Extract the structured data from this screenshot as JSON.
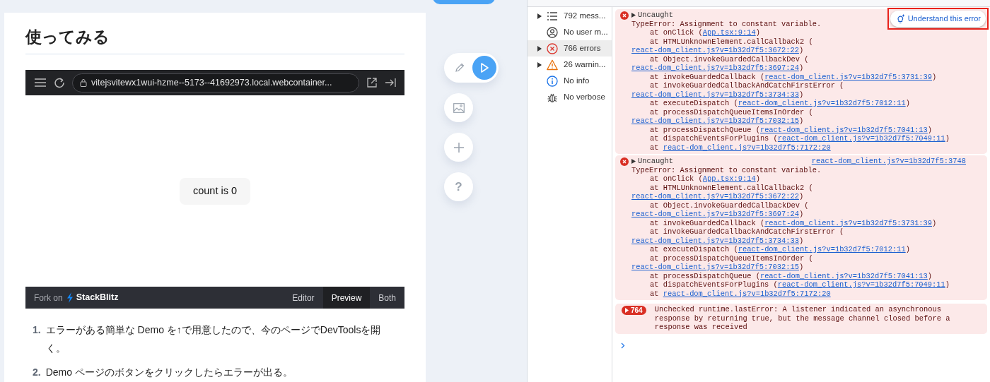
{
  "article": {
    "heading": "使ってみる",
    "embed": {
      "url": "vitejsvitewx1wui-hzme--5173--41692973.local.webcontainer...",
      "preview_button": "count is 0",
      "fork_label": "Fork on",
      "brand": "StackBlitz",
      "tabs": [
        {
          "label": "Editor",
          "selected": false
        },
        {
          "label": "Preview",
          "selected": true
        },
        {
          "label": "Both",
          "selected": false
        }
      ]
    },
    "steps": [
      {
        "number": "1.",
        "text": "エラーがある簡単な Demo を↑で用意したので、今のページでDevToolsを開く。"
      },
      {
        "number": "2.",
        "text": "Demo ページのボタンをクリックしたらエラーが出る。"
      }
    ]
  },
  "floating_tools": [
    {
      "kind": "edit-run"
    },
    {
      "kind": "image"
    },
    {
      "kind": "add"
    },
    {
      "kind": "help",
      "label": "?"
    }
  ],
  "console_sidebar": [
    {
      "kind": "list",
      "label": "792 mess...",
      "expandable": true,
      "selected": false
    },
    {
      "kind": "user",
      "label": "No user m...",
      "expandable": false,
      "selected": false
    },
    {
      "kind": "error",
      "label": "766 errors",
      "expandable": true,
      "selected": true
    },
    {
      "kind": "warning",
      "label": "26 warnin...",
      "expandable": true,
      "selected": false
    },
    {
      "kind": "info",
      "label": "No info",
      "expandable": false,
      "selected": false
    },
    {
      "kind": "verbose",
      "label": "No verbose",
      "expandable": false,
      "selected": false
    }
  ],
  "messages": [
    {
      "kind": "error",
      "summary": "Uncaught",
      "ai_button": "Understand this error",
      "lines": [
        {
          "kind": "message",
          "parts": [
            {
              "text": "TypeError: Assignment to constant variable."
            }
          ]
        },
        {
          "kind": "frame",
          "parts": [
            {
              "text": "at onClick ("
            },
            {
              "text": "App.tsx:9:14",
              "link": true
            },
            {
              "text": ")"
            }
          ]
        },
        {
          "kind": "frame",
          "parts": [
            {
              "text": "at HTMLUnknownElement.callCallback2 ("
            }
          ]
        },
        {
          "kind": "wrap",
          "parts": [
            {
              "text": "react-dom_client.js?v=1b32d7f5:3672:22",
              "link": true
            },
            {
              "text": ")"
            }
          ]
        },
        {
          "kind": "frame",
          "parts": [
            {
              "text": "at Object.invokeGuardedCallbackDev ("
            }
          ]
        },
        {
          "kind": "wrap",
          "parts": [
            {
              "text": "react-dom_client.js?v=1b32d7f5:3697:24",
              "link": true
            },
            {
              "text": ")"
            }
          ]
        },
        {
          "kind": "frame",
          "parts": [
            {
              "text": "at invokeGuardedCallback ("
            },
            {
              "text": "react-dom_client.js?v=1b32d7f5:3731:39",
              "link": true
            },
            {
              "text": ")"
            }
          ]
        },
        {
          "kind": "frame",
          "parts": [
            {
              "text": "at invokeGuardedCallbackAndCatchFirstError ("
            }
          ]
        },
        {
          "kind": "wrap",
          "parts": [
            {
              "text": "react-dom_client.js?v=1b32d7f5:3734:33",
              "link": true
            },
            {
              "text": ")"
            }
          ]
        },
        {
          "kind": "frame",
          "parts": [
            {
              "text": "at executeDispatch ("
            },
            {
              "text": "react-dom_client.js?v=1b32d7f5:7012:11",
              "link": true
            },
            {
              "text": ")"
            }
          ]
        },
        {
          "kind": "frame",
          "parts": [
            {
              "text": "at processDispatchQueueItemsInOrder ("
            }
          ]
        },
        {
          "kind": "wrap",
          "parts": [
            {
              "text": "react-dom_client.js?v=1b32d7f5:7032:15",
              "link": true
            },
            {
              "text": ")"
            }
          ]
        },
        {
          "kind": "frame",
          "parts": [
            {
              "text": "at processDispatchQueue ("
            },
            {
              "text": "react-dom_client.js?v=1b32d7f5:7041:13",
              "link": true
            },
            {
              "text": ")"
            }
          ]
        },
        {
          "kind": "frame",
          "parts": [
            {
              "text": "at dispatchEventsForPlugins ("
            },
            {
              "text": "react-dom_client.js?v=1b32d7f5:7049:11",
              "link": true
            },
            {
              "text": ")"
            }
          ]
        },
        {
          "kind": "frame",
          "parts": [
            {
              "text": "at "
            },
            {
              "text": "react-dom_client.js?v=1b32d7f5:7172:20",
              "link": true
            }
          ]
        }
      ]
    },
    {
      "kind": "error",
      "summary": "Uncaught",
      "source": "react-dom_client.js?v=1b32d7f5:3748",
      "lines": [
        {
          "kind": "message",
          "parts": [
            {
              "text": "TypeError: Assignment to constant variable."
            }
          ]
        },
        {
          "kind": "frame",
          "parts": [
            {
              "text": "at onClick ("
            },
            {
              "text": "App.tsx:9:14",
              "link": true
            },
            {
              "text": ")"
            }
          ]
        },
        {
          "kind": "frame",
          "parts": [
            {
              "text": "at HTMLUnknownElement.callCallback2 ("
            }
          ]
        },
        {
          "kind": "wrap",
          "parts": [
            {
              "text": "react-dom_client.js?v=1b32d7f5:3672:22",
              "link": true
            },
            {
              "text": ")"
            }
          ]
        },
        {
          "kind": "frame",
          "parts": [
            {
              "text": "at Object.invokeGuardedCallbackDev ("
            }
          ]
        },
        {
          "kind": "wrap",
          "parts": [
            {
              "text": "react-dom_client.js?v=1b32d7f5:3697:24",
              "link": true
            },
            {
              "text": ")"
            }
          ]
        },
        {
          "kind": "frame",
          "parts": [
            {
              "text": "at invokeGuardedCallback ("
            },
            {
              "text": "react-dom_client.js?v=1b32d7f5:3731:39",
              "link": true
            },
            {
              "text": ")"
            }
          ]
        },
        {
          "kind": "frame",
          "parts": [
            {
              "text": "at invokeGuardedCallbackAndCatchFirstError ("
            }
          ]
        },
        {
          "kind": "wrap",
          "parts": [
            {
              "text": "react-dom_client.js?v=1b32d7f5:3734:33",
              "link": true
            },
            {
              "text": ")"
            }
          ]
        },
        {
          "kind": "frame",
          "parts": [
            {
              "text": "at executeDispatch ("
            },
            {
              "text": "react-dom_client.js?v=1b32d7f5:7012:11",
              "link": true
            },
            {
              "text": ")"
            }
          ]
        },
        {
          "kind": "frame",
          "parts": [
            {
              "text": "at processDispatchQueueItemsInOrder ("
            }
          ]
        },
        {
          "kind": "wrap",
          "parts": [
            {
              "text": "react-dom_client.js?v=1b32d7f5:7032:15",
              "link": true
            },
            {
              "text": ")"
            }
          ]
        },
        {
          "kind": "frame",
          "parts": [
            {
              "text": "at processDispatchQueue ("
            },
            {
              "text": "react-dom_client.js?v=1b32d7f5:7041:13",
              "link": true
            },
            {
              "text": ")"
            }
          ]
        },
        {
          "kind": "frame",
          "parts": [
            {
              "text": "at dispatchEventsForPlugins ("
            },
            {
              "text": "react-dom_client.js?v=1b32d7f5:7049:11",
              "link": true
            },
            {
              "text": ")"
            }
          ]
        },
        {
          "kind": "frame",
          "parts": [
            {
              "text": "at "
            },
            {
              "text": "react-dom_client.js?v=1b32d7f5:7172:20",
              "link": true
            }
          ]
        }
      ]
    },
    {
      "kind": "repeated",
      "count": "764",
      "text": "Unchecked runtime.lastError: A listener indicated an asynchronous response by returning true, but the message channel closed before a response was received"
    }
  ]
}
